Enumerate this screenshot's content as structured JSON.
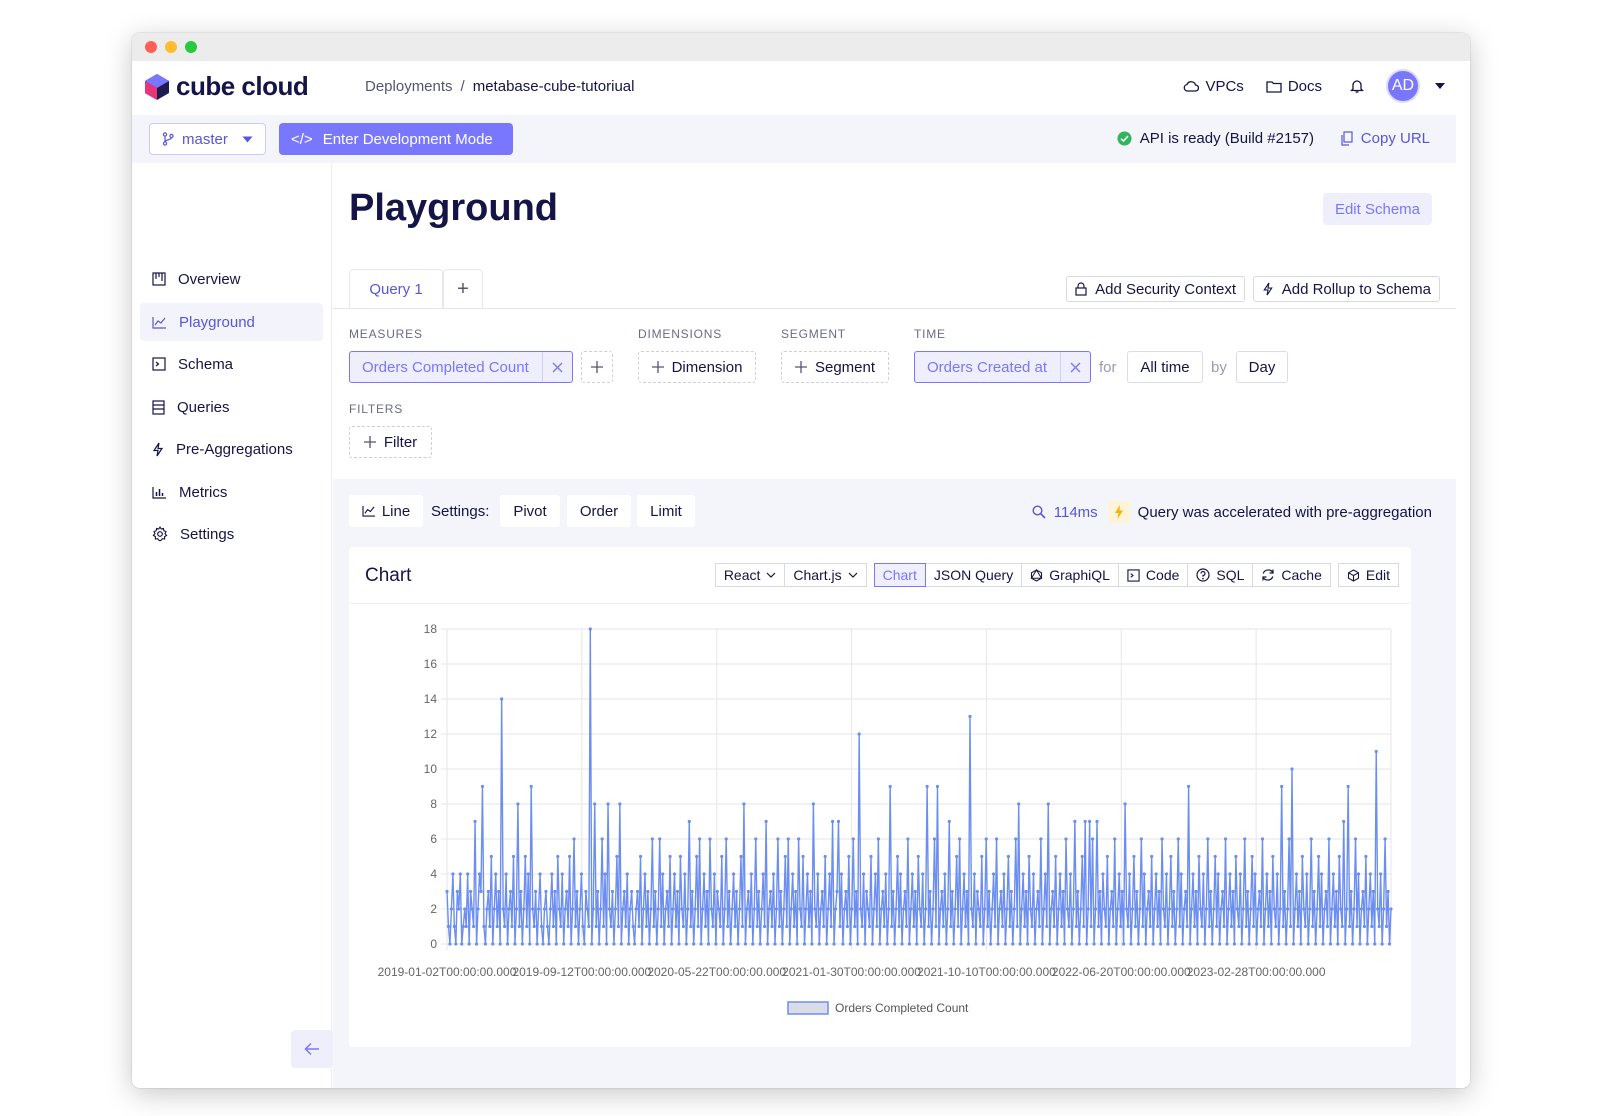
{
  "app": {
    "logo_text": "cube cloud",
    "breadcrumb": {
      "parent": "Deployments",
      "separator": "/",
      "current": "metabase-cube-tutoriual"
    },
    "top_nav": {
      "vpcs": "VPCs",
      "docs": "Docs",
      "avatar_initials": "AD"
    }
  },
  "subbar": {
    "branch": "master",
    "dev_mode": "Enter Development Mode",
    "dev_mode_icon": "</>",
    "api_status": "API is ready (Build #2157)",
    "copy_url": "Copy URL"
  },
  "sidebar": {
    "items": [
      {
        "label": "Overview",
        "icon": "overview-icon",
        "active": false
      },
      {
        "label": "Playground",
        "icon": "chart-line-icon",
        "active": true
      },
      {
        "label": "Schema",
        "icon": "terminal-icon",
        "active": false
      },
      {
        "label": "Queries",
        "icon": "list-icon",
        "active": false
      },
      {
        "label": "Pre-Aggregations",
        "icon": "bolt-icon",
        "active": false
      },
      {
        "label": "Metrics",
        "icon": "bar-chart-icon",
        "active": false
      },
      {
        "label": "Settings",
        "icon": "gear-icon",
        "active": false
      }
    ]
  },
  "page": {
    "title": "Playground",
    "edit_schema": "Edit Schema",
    "tab_query": "Query 1",
    "tab_add": "+",
    "add_security_context": "Add Security Context",
    "add_rollup": "Add Rollup to Schema"
  },
  "query": {
    "measures_label": "MEASURES",
    "measure": "Orders Completed Count",
    "dimensions_label": "DIMENSIONS",
    "dimension_btn": "Dimension",
    "segment_label": "SEGMENT",
    "segment_btn": "Segment",
    "time_label": "TIME",
    "time_dimension": "Orders Created at",
    "for_label": "for",
    "date_range": "All time",
    "by_label": "by",
    "granularity": "Day",
    "filters_label": "FILTERS",
    "filter_btn": "Filter"
  },
  "settings_bar": {
    "chart_type": "Line",
    "settings_label": "Settings:",
    "pivot": "Pivot",
    "order": "Order",
    "limit": "Limit",
    "duration": "114ms",
    "accelerated": "Query was accelerated with pre-aggregation"
  },
  "chart_card": {
    "title": "Chart",
    "framework": "React",
    "library": "Chart.js",
    "tabs": [
      "Chart",
      "JSON Query",
      "GraphiQL",
      "Code",
      "SQL",
      "Cache"
    ],
    "edit": "Edit"
  },
  "chart_data": {
    "type": "line",
    "x_tick_labels": [
      "2019-01-02T00:00:00.000",
      "2019-09-12T00:00:00.000",
      "2020-05-22T00:00:00.000",
      "2021-01-30T00:00:00.000",
      "2021-10-10T00:00:00.000",
      "2022-06-20T00:00:00.000",
      "2023-02-28T00:00:00.000"
    ],
    "x_range": [
      "2019-01-02",
      "2024-05-08"
    ],
    "granularity": "day",
    "ylim": [
      0,
      18
    ],
    "y_ticks": [
      0,
      2,
      4,
      6,
      8,
      10,
      12,
      14,
      16,
      18
    ],
    "grid": true,
    "legend": "bottom",
    "series": [
      {
        "name": "Orders Completed Count",
        "color": "#6b8ef0",
        "values": [
          3,
          1,
          0,
          2,
          4,
          1,
          0,
          3,
          2,
          4,
          0,
          1,
          2,
          1,
          4,
          0,
          3,
          2,
          1,
          7,
          0,
          2,
          4,
          3,
          9,
          1,
          0,
          2,
          3,
          1,
          5,
          0,
          2,
          4,
          1,
          3,
          0,
          14,
          2,
          1,
          4,
          0,
          2,
          3,
          1,
          5,
          0,
          2,
          8,
          1,
          3,
          0,
          2,
          5,
          1,
          4,
          0,
          9,
          2,
          1,
          3,
          0,
          2,
          4,
          1,
          0,
          2,
          3,
          1,
          0,
          2,
          4,
          1,
          3,
          0,
          5,
          2,
          1,
          4,
          0,
          2,
          3,
          1,
          5,
          0,
          2,
          6,
          1,
          3,
          0,
          2,
          4,
          1,
          0,
          3,
          2,
          1,
          18,
          0,
          2,
          8,
          1,
          3,
          0,
          2,
          6,
          1,
          4,
          0,
          8,
          2,
          1,
          3,
          0,
          2,
          5,
          1,
          8,
          0,
          2,
          3,
          1,
          4,
          0,
          2,
          3,
          1,
          0,
          2,
          3,
          1,
          5,
          0,
          2,
          4,
          1,
          3,
          0,
          2,
          6,
          1,
          3,
          0,
          2,
          6,
          1,
          4,
          0,
          2,
          3,
          1,
          5,
          0,
          2,
          4,
          1,
          3,
          0,
          5,
          2,
          1,
          4,
          0,
          2,
          7,
          1,
          3,
          0,
          2,
          5,
          1,
          6,
          0,
          2,
          4,
          1,
          3,
          0,
          6,
          2,
          1,
          4,
          0,
          3,
          2,
          1,
          5,
          0,
          2,
          6,
          1,
          3,
          0,
          2,
          4,
          1,
          3,
          0,
          2,
          5,
          1,
          8,
          0,
          2,
          3,
          1,
          4,
          0,
          2,
          6,
          1,
          3,
          0,
          2,
          4,
          1,
          7,
          0,
          2,
          3,
          1,
          4,
          0,
          2,
          6,
          1,
          3,
          0,
          2,
          5,
          1,
          6,
          0,
          2,
          4,
          1,
          3,
          0,
          6,
          2,
          1,
          5,
          0,
          2,
          4,
          1,
          3,
          0,
          8,
          2,
          1,
          4,
          0,
          2,
          3,
          1,
          5,
          0,
          2,
          4,
          1,
          7,
          0,
          2,
          3,
          7,
          1,
          4,
          0,
          2,
          3,
          1,
          5,
          0,
          2,
          6,
          1,
          3,
          0,
          12,
          2,
          1,
          4,
          0,
          3,
          2,
          1,
          5,
          0,
          2,
          4,
          1,
          6,
          0,
          2,
          3,
          1,
          4,
          0,
          2,
          9,
          1,
          3,
          0,
          2,
          5,
          1,
          4,
          0,
          2,
          3,
          1,
          6,
          0,
          2,
          4,
          1,
          3,
          0,
          5,
          2,
          1,
          4,
          0,
          2,
          9,
          1,
          3,
          0,
          2,
          6,
          1,
          9,
          0,
          2,
          3,
          1,
          4,
          0,
          2,
          7,
          1,
          3,
          0,
          2,
          5,
          1,
          6,
          0,
          2,
          4,
          1,
          3,
          0,
          13,
          2,
          1,
          4,
          0,
          3,
          2,
          1,
          5,
          0,
          2,
          6,
          1,
          3,
          0,
          2,
          4,
          1,
          6,
          0,
          2,
          3,
          1,
          4,
          0,
          2,
          5,
          1,
          3,
          0,
          2,
          6,
          1,
          8,
          0,
          2,
          4,
          1,
          3,
          0,
          5,
          2,
          1,
          4,
          0,
          2,
          3,
          1,
          6,
          0,
          2,
          4,
          1,
          8,
          0,
          2,
          3,
          1,
          5,
          0,
          2,
          4,
          1,
          3,
          0,
          6,
          2,
          1,
          4,
          0,
          2,
          7,
          1,
          3,
          0,
          2,
          5,
          1,
          7,
          0,
          2,
          7,
          1,
          6,
          0,
          2,
          7,
          1,
          3,
          0,
          4,
          2,
          1,
          5,
          0,
          2,
          3,
          1,
          6,
          0,
          2,
          4,
          1,
          3,
          0,
          8,
          2,
          1,
          4,
          0,
          2,
          5,
          1,
          3,
          0,
          2,
          6,
          1,
          4,
          0,
          2,
          3,
          1,
          5,
          0,
          2,
          4,
          1,
          3,
          0,
          6,
          2,
          1,
          4,
          0,
          2,
          5,
          1,
          3,
          0,
          2,
          6,
          1,
          4,
          0,
          2,
          3,
          1,
          9,
          0,
          2,
          4,
          1,
          3,
          0,
          5,
          2,
          1,
          4,
          0,
          2,
          6,
          1,
          3,
          0,
          2,
          5,
          1,
          4,
          0,
          2,
          3,
          1,
          6,
          0,
          2,
          4,
          1,
          3,
          0,
          5,
          2,
          1,
          4,
          0,
          2,
          6,
          1,
          3,
          0,
          2,
          5,
          1,
          4,
          0,
          2,
          3,
          1,
          6,
          0,
          2,
          4,
          1,
          3,
          0,
          5,
          2,
          1,
          4,
          0,
          2,
          9,
          1,
          3,
          0,
          2,
          6,
          1,
          10,
          0,
          2,
          4,
          1,
          3,
          0,
          5,
          2,
          1,
          4,
          0,
          2,
          6,
          1,
          3,
          0,
          2,
          5,
          1,
          4,
          0,
          2,
          3,
          1,
          6,
          0,
          2,
          4,
          1,
          3,
          0,
          5,
          2,
          1,
          7,
          0,
          2,
          9,
          1,
          3,
          0,
          2,
          6,
          1,
          4,
          0,
          2,
          3,
          1,
          5,
          0,
          2,
          4,
          1,
          3,
          0,
          11,
          2,
          1,
          4,
          0,
          2,
          6,
          1,
          3,
          0,
          2
        ]
      }
    ]
  },
  "colors": {
    "accent": "#7a77ff",
    "accent_text": "#5856d6",
    "line": "#6b8ef0",
    "status_ok": "#2fb55d"
  }
}
